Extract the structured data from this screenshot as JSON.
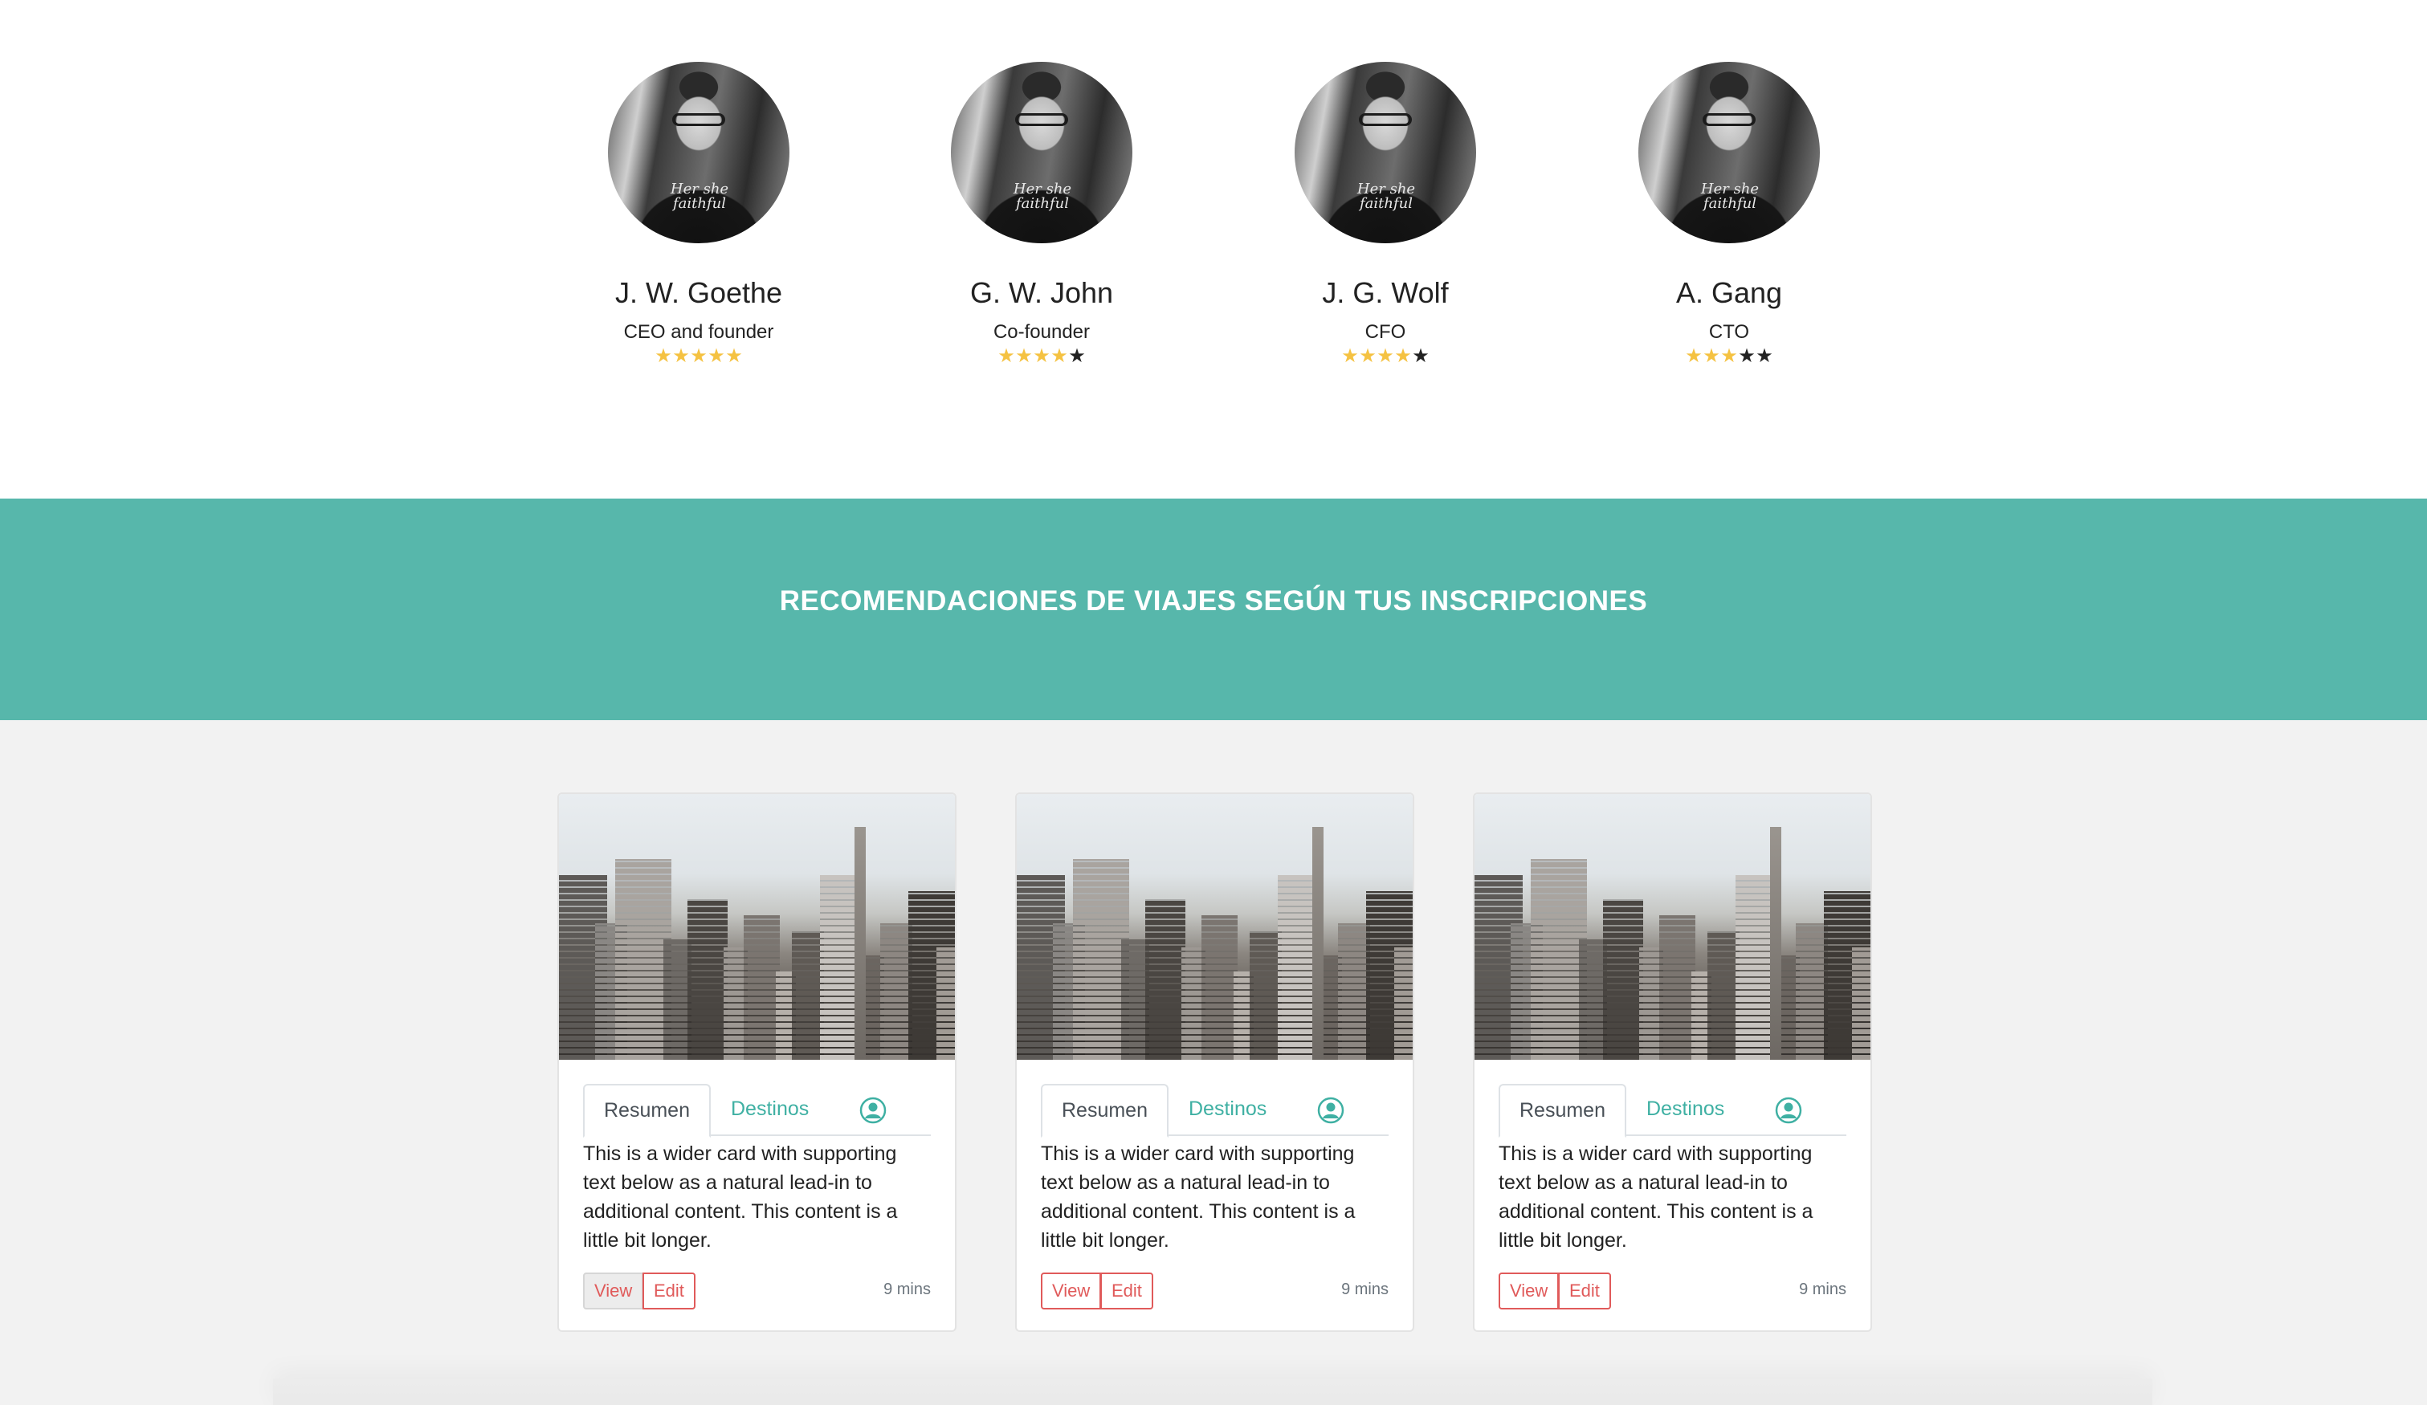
{
  "team": {
    "members": [
      {
        "name": "J. W. Goethe",
        "role": "CEO and founder",
        "rating": 5,
        "rating_max": 5
      },
      {
        "name": "G. W. John",
        "role": "Co-founder",
        "rating": 4,
        "rating_max": 5
      },
      {
        "name": "J. G. Wolf",
        "role": "CFO",
        "rating": 4,
        "rating_max": 5
      },
      {
        "name": "A. Gang",
        "role": "CTO",
        "rating": 3,
        "rating_max": 5
      }
    ],
    "avatar_script": "Her she faithful"
  },
  "banner": {
    "title": "RECOMENDACIONES DE VIAJES SEGÚN TUS INSCRIPCIONES"
  },
  "cards": [
    {
      "tab_active": "Resumen",
      "tab_link": "Destinos",
      "text": "This is a wider card with supporting text below as a natural lead-in to additional content. This content is a little bit longer.",
      "view_label": "View",
      "edit_label": "Edit",
      "time": "9 mins"
    },
    {
      "tab_active": "Resumen",
      "tab_link": "Destinos",
      "text": "This is a wider card with supporting text below as a natural lead-in to additional content. This content is a little bit longer.",
      "view_label": "View",
      "edit_label": "Edit",
      "time": "9 mins"
    },
    {
      "tab_active": "Resumen",
      "tab_link": "Destinos",
      "text": "This is a wider card with supporting text below as a natural lead-in to additional content. This content is a little bit longer.",
      "view_label": "View",
      "edit_label": "Edit",
      "time": "9 mins"
    }
  ],
  "icons": {
    "avatar": "profile-photo",
    "star": "star-icon",
    "user": "user-circle-icon"
  },
  "colors": {
    "banner_bg": "#57b7ab",
    "accent_teal": "#3fb0a3",
    "star_on": "#f5c242",
    "star_off": "#222222",
    "button_red": "#e05a5a",
    "section_gray": "#f2f2f2"
  }
}
